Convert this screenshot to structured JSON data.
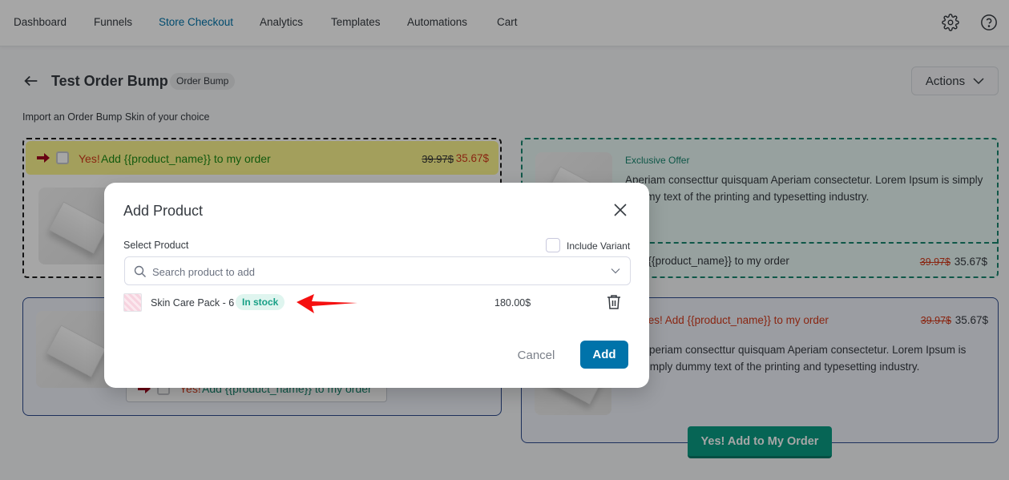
{
  "nav": {
    "items": [
      {
        "label": "Dashboard",
        "active": false
      },
      {
        "label": "Funnels",
        "active": false
      },
      {
        "label": "Store Checkout",
        "active": true
      },
      {
        "label": "Analytics",
        "active": false
      },
      {
        "label": "Templates",
        "active": false
      },
      {
        "label": "Automations",
        "active": false
      },
      {
        "label": "Cart",
        "active": false
      }
    ],
    "icons": [
      "gear-icon",
      "help-icon"
    ]
  },
  "header": {
    "title": "Test Order Bump",
    "type_badge": "Order Bump",
    "actions_label": "Actions",
    "subtitle": "Import an Order Bump Skin of your choice"
  },
  "skins": {
    "skin1": {
      "yes": "Yes!",
      "text": "Add {{product_name}} to my order",
      "old_price": "39.97$",
      "new_price": "35.67$"
    },
    "skin2": {
      "offer": "Exclusive Offer",
      "description": "Aperiam consecttur quisquam Aperiam consectetur. Lorem Ipsum is simply dummy text of the printing and typesetting industry.",
      "footer_text": "Yes! Add {{product_name}} to my order",
      "old_price": "39.97$",
      "new_price": "35.67$"
    },
    "skin3": {
      "yes": "Yes!",
      "text": "Add {{product_name}} to my order"
    },
    "skin4": {
      "headline": "Yes! Add {{product_name}} to my order",
      "old_price": "39.97$",
      "new_price": "35.67$",
      "description": "Aperiam consecttur quisquam Aperiam consectetur. Lorem Ipsum is simply dummy text of the printing and typesetting industry.",
      "button_label": "Yes! Add to My Order"
    }
  },
  "modal": {
    "title": "Add Product",
    "select_label": "Select Product",
    "include_variant_label": "Include Variant",
    "include_variant_checked": false,
    "search_placeholder": "Search product to add",
    "search_value": "",
    "products": [
      {
        "name": "Skin Care Pack - 6",
        "stock": "In stock",
        "price": "180.00$"
      }
    ],
    "cancel_label": "Cancel",
    "add_label": "Add"
  },
  "colors": {
    "accent": "#0073aa",
    "stock_green": "#17a086",
    "offer_green": "#17866f",
    "price_red": "#d33a1b",
    "pointer_red": "#f51010"
  }
}
